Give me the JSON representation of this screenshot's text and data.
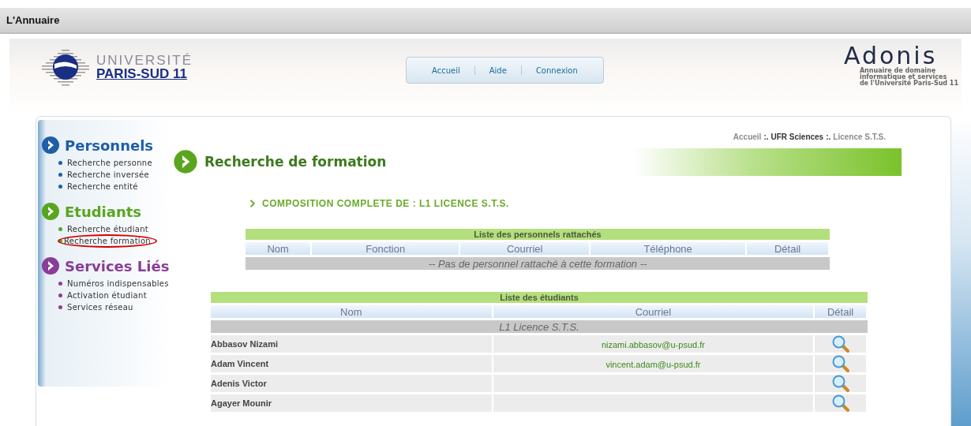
{
  "app_title": "L'Annuaire",
  "header": {
    "logo": {
      "line1": "UNIVERSITÉ",
      "line2": "PARIS-SUD 11"
    },
    "nav": [
      {
        "label": "Accueil"
      },
      {
        "label": "Aide"
      },
      {
        "label": "Connexion"
      }
    ],
    "brand": {
      "name": "Adonis",
      "tagline": [
        "Annuaire de domaine",
        "informatique et services",
        "de l'Université Paris-Sud 11"
      ]
    }
  },
  "sidebar": [
    {
      "title": "Personnels",
      "color": "#1f5ea8",
      "items": [
        {
          "label": "Recherche personne",
          "circled": false
        },
        {
          "label": "Recherche inversée",
          "circled": false
        },
        {
          "label": "Recherche entité",
          "circled": false
        }
      ]
    },
    {
      "title": "Etudiants",
      "color": "#5aa51e",
      "items": [
        {
          "label": "Recherche étudiant",
          "circled": false
        },
        {
          "label": "Recherche formation",
          "circled": true
        }
      ]
    },
    {
      "title": "Services Liés",
      "color": "#8a3d96",
      "items": [
        {
          "label": "Numéros indispensables",
          "circled": false
        },
        {
          "label": "Activation étudiant",
          "circled": false
        },
        {
          "label": "Services réseau",
          "circled": false
        }
      ]
    }
  ],
  "breadcrumb": [
    {
      "label": "Accueil",
      "kind": "link"
    },
    {
      "label": ":.",
      "kind": "sep"
    },
    {
      "label": "UFR Sciences",
      "kind": "current"
    },
    {
      "label": ":.",
      "kind": "sep"
    },
    {
      "label": "Licence S.T.S.",
      "kind": "link"
    }
  ],
  "page_title": "Recherche de formation",
  "subtitle": "COMPOSITION COMPLETE DE : L1 LICENCE S.T.S.",
  "staff_table": {
    "title": "Liste des personnels rattachés",
    "columns": [
      "Nom",
      "Fonction",
      "Courriel",
      "Téléphone",
      "Détail"
    ],
    "empty_message": "-- Pas de personnel rattaché à cette formation --"
  },
  "students_table": {
    "title": "Liste des étudiants",
    "columns": [
      "Nom",
      "Courriel",
      "Détail"
    ],
    "group": "L1 Licence S.T.S.",
    "rows": [
      {
        "name": "Abbasov Nizami",
        "email": "nizami.abbasov@u-psud.fr"
      },
      {
        "name": "Adam Vincent",
        "email": "vincent.adam@u-psud.fr"
      },
      {
        "name": "Adenis Victor"
      },
      {
        "name": "Agayer Mounir"
      }
    ]
  }
}
